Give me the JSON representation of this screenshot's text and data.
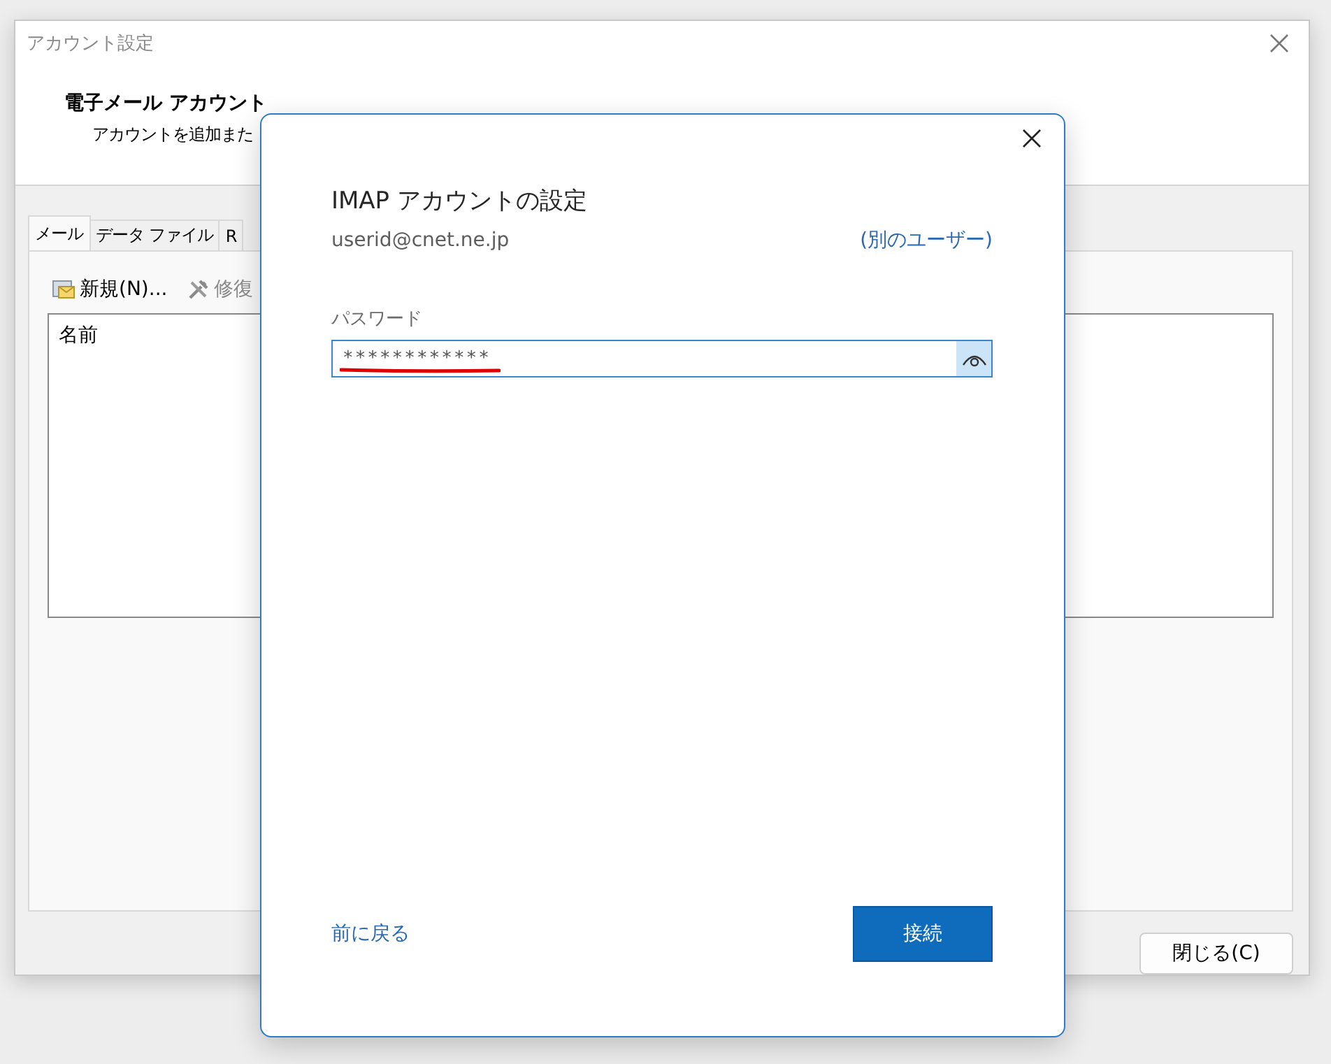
{
  "window": {
    "title": "アカウント設定",
    "heading": "電子メール アカウント",
    "description": "アカウントを追加また"
  },
  "tabs": [
    {
      "label": "メール",
      "selected": true
    },
    {
      "label": "データ ファイル",
      "selected": false
    },
    {
      "label": "R",
      "selected": false
    }
  ],
  "toolbar": [
    {
      "label": "新規(N)...",
      "kind": "new"
    },
    {
      "label": "修復",
      "kind": "repair"
    }
  ],
  "list": {
    "column_1": "名前"
  },
  "close_button": "閉じる(C)",
  "dialog": {
    "title": "IMAP アカウントの設定",
    "email": "userid@cnet.ne.jp",
    "other_user_link": "(別のユーザー)",
    "password_label": "パスワード",
    "password_value": "************",
    "back_link": "前に戻る",
    "connect_button": "接続"
  }
}
